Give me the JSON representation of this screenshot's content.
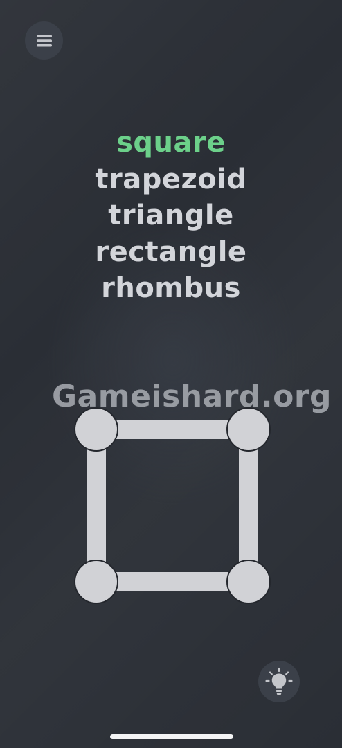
{
  "menu": {
    "icon": "hamburger-menu-icon"
  },
  "words": [
    {
      "text": "square",
      "state": "solved"
    },
    {
      "text": "trapezoid",
      "state": "pending"
    },
    {
      "text": "triangle",
      "state": "pending"
    },
    {
      "text": "rectangle",
      "state": "pending"
    },
    {
      "text": "rhombus",
      "state": "pending"
    }
  ],
  "watermark": "Gameishard.org",
  "hint": {
    "icon": "lightbulb-icon"
  },
  "colors": {
    "background": "#2a2e35",
    "solved_word": "#6cd08a",
    "pending_word": "#d3d5da",
    "node": "#d1d2d6",
    "button_bg": "#3b4049"
  }
}
